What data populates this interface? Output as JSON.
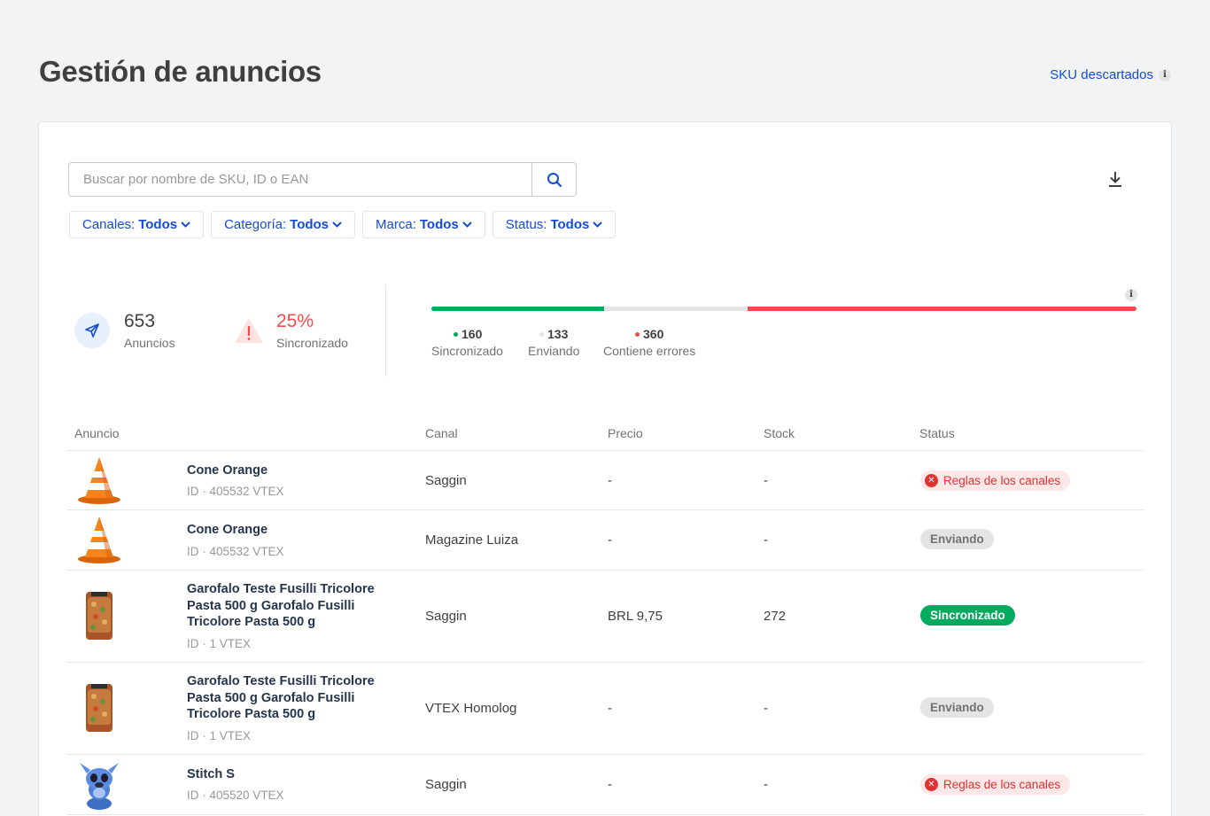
{
  "header": {
    "title": "Gestión de anuncios",
    "sku_link": "SKU descartados",
    "info_glyph": "i"
  },
  "search": {
    "placeholder": "Buscar por nombre de SKU, ID o EAN",
    "value": ""
  },
  "filters": [
    {
      "label": "Canales:",
      "value": "Todos"
    },
    {
      "label": "Categoría:",
      "value": "Todos"
    },
    {
      "label": "Marca:",
      "value": "Todos"
    },
    {
      "label": "Status:",
      "value": "Todos"
    }
  ],
  "stats": {
    "anuncios": {
      "value": "653",
      "label": "Anuncios",
      "icon": "paper-plane-icon"
    },
    "sync": {
      "value": "25%",
      "label": "Sincronizado",
      "icon": "warning-triangle-icon"
    }
  },
  "progress": {
    "segments": [
      {
        "value": 160,
        "label": "Sincronizado",
        "color": "#00ab5e"
      },
      {
        "value": 133,
        "label": "Enviando",
        "color": "#e3e4e6"
      },
      {
        "value": 360,
        "label": "Contiene errores",
        "color": "#f04b4b"
      }
    ]
  },
  "table": {
    "headers": [
      "Anuncio",
      "Canal",
      "Precio",
      "Stock",
      "Status"
    ],
    "rows": [
      {
        "name": "Cone Orange",
        "id": "ID · 405532 VTEX",
        "canal": "Saggin",
        "precio": "-",
        "stock": "-",
        "status": "Reglas de los canales",
        "status_type": "err",
        "thumb": "cone"
      },
      {
        "name": "Cone Orange",
        "id": "ID · 405532 VTEX",
        "canal": "Magazine Luiza",
        "precio": "-",
        "stock": "-",
        "status": "Enviando",
        "status_type": "send",
        "thumb": "cone"
      },
      {
        "name": "Garofalo Teste Fusilli Tricolore Pasta 500 g Garofalo Fusilli Tricolore Pasta 500 g",
        "id": "ID · 1 VTEX",
        "canal": "Saggin",
        "precio": "BRL 9,75",
        "stock": "272",
        "status": "Sincronizado",
        "status_type": "ok",
        "thumb": "pasta"
      },
      {
        "name": "Garofalo Teste Fusilli Tricolore Pasta 500 g Garofalo Fusilli Tricolore Pasta 500 g",
        "id": "ID · 1 VTEX",
        "canal": "VTEX Homolog",
        "precio": "-",
        "stock": "-",
        "status": "Enviando",
        "status_type": "send",
        "thumb": "pasta"
      },
      {
        "name": "Stitch S",
        "id": "ID · 405520 VTEX",
        "canal": "Saggin",
        "precio": "-",
        "stock": "-",
        "status": "Reglas de los canales",
        "status_type": "err",
        "thumb": "stitch"
      }
    ]
  }
}
